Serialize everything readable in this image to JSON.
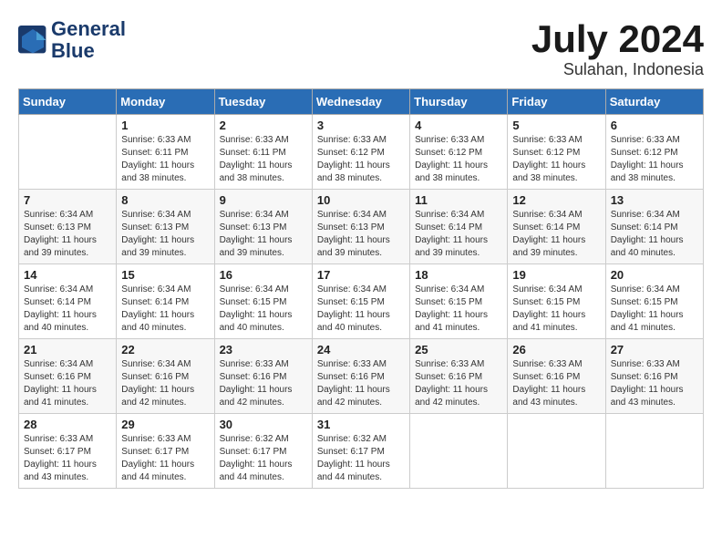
{
  "header": {
    "logo_line1": "General",
    "logo_line2": "Blue",
    "month": "July 2024",
    "location": "Sulahan, Indonesia"
  },
  "columns": [
    "Sunday",
    "Monday",
    "Tuesday",
    "Wednesday",
    "Thursday",
    "Friday",
    "Saturday"
  ],
  "weeks": [
    [
      {
        "day": "",
        "info": ""
      },
      {
        "day": "1",
        "info": "Sunrise: 6:33 AM\nSunset: 6:11 PM\nDaylight: 11 hours\nand 38 minutes."
      },
      {
        "day": "2",
        "info": "Sunrise: 6:33 AM\nSunset: 6:11 PM\nDaylight: 11 hours\nand 38 minutes."
      },
      {
        "day": "3",
        "info": "Sunrise: 6:33 AM\nSunset: 6:12 PM\nDaylight: 11 hours\nand 38 minutes."
      },
      {
        "day": "4",
        "info": "Sunrise: 6:33 AM\nSunset: 6:12 PM\nDaylight: 11 hours\nand 38 minutes."
      },
      {
        "day": "5",
        "info": "Sunrise: 6:33 AM\nSunset: 6:12 PM\nDaylight: 11 hours\nand 38 minutes."
      },
      {
        "day": "6",
        "info": "Sunrise: 6:33 AM\nSunset: 6:12 PM\nDaylight: 11 hours\nand 38 minutes."
      }
    ],
    [
      {
        "day": "7",
        "info": "Sunrise: 6:34 AM\nSunset: 6:13 PM\nDaylight: 11 hours\nand 39 minutes."
      },
      {
        "day": "8",
        "info": "Sunrise: 6:34 AM\nSunset: 6:13 PM\nDaylight: 11 hours\nand 39 minutes."
      },
      {
        "day": "9",
        "info": "Sunrise: 6:34 AM\nSunset: 6:13 PM\nDaylight: 11 hours\nand 39 minutes."
      },
      {
        "day": "10",
        "info": "Sunrise: 6:34 AM\nSunset: 6:13 PM\nDaylight: 11 hours\nand 39 minutes."
      },
      {
        "day": "11",
        "info": "Sunrise: 6:34 AM\nSunset: 6:14 PM\nDaylight: 11 hours\nand 39 minutes."
      },
      {
        "day": "12",
        "info": "Sunrise: 6:34 AM\nSunset: 6:14 PM\nDaylight: 11 hours\nand 39 minutes."
      },
      {
        "day": "13",
        "info": "Sunrise: 6:34 AM\nSunset: 6:14 PM\nDaylight: 11 hours\nand 40 minutes."
      }
    ],
    [
      {
        "day": "14",
        "info": "Sunrise: 6:34 AM\nSunset: 6:14 PM\nDaylight: 11 hours\nand 40 minutes."
      },
      {
        "day": "15",
        "info": "Sunrise: 6:34 AM\nSunset: 6:14 PM\nDaylight: 11 hours\nand 40 minutes."
      },
      {
        "day": "16",
        "info": "Sunrise: 6:34 AM\nSunset: 6:15 PM\nDaylight: 11 hours\nand 40 minutes."
      },
      {
        "day": "17",
        "info": "Sunrise: 6:34 AM\nSunset: 6:15 PM\nDaylight: 11 hours\nand 40 minutes."
      },
      {
        "day": "18",
        "info": "Sunrise: 6:34 AM\nSunset: 6:15 PM\nDaylight: 11 hours\nand 41 minutes."
      },
      {
        "day": "19",
        "info": "Sunrise: 6:34 AM\nSunset: 6:15 PM\nDaylight: 11 hours\nand 41 minutes."
      },
      {
        "day": "20",
        "info": "Sunrise: 6:34 AM\nSunset: 6:15 PM\nDaylight: 11 hours\nand 41 minutes."
      }
    ],
    [
      {
        "day": "21",
        "info": "Sunrise: 6:34 AM\nSunset: 6:16 PM\nDaylight: 11 hours\nand 41 minutes."
      },
      {
        "day": "22",
        "info": "Sunrise: 6:34 AM\nSunset: 6:16 PM\nDaylight: 11 hours\nand 42 minutes."
      },
      {
        "day": "23",
        "info": "Sunrise: 6:33 AM\nSunset: 6:16 PM\nDaylight: 11 hours\nand 42 minutes."
      },
      {
        "day": "24",
        "info": "Sunrise: 6:33 AM\nSunset: 6:16 PM\nDaylight: 11 hours\nand 42 minutes."
      },
      {
        "day": "25",
        "info": "Sunrise: 6:33 AM\nSunset: 6:16 PM\nDaylight: 11 hours\nand 42 minutes."
      },
      {
        "day": "26",
        "info": "Sunrise: 6:33 AM\nSunset: 6:16 PM\nDaylight: 11 hours\nand 43 minutes."
      },
      {
        "day": "27",
        "info": "Sunrise: 6:33 AM\nSunset: 6:16 PM\nDaylight: 11 hours\nand 43 minutes."
      }
    ],
    [
      {
        "day": "28",
        "info": "Sunrise: 6:33 AM\nSunset: 6:17 PM\nDaylight: 11 hours\nand 43 minutes."
      },
      {
        "day": "29",
        "info": "Sunrise: 6:33 AM\nSunset: 6:17 PM\nDaylight: 11 hours\nand 44 minutes."
      },
      {
        "day": "30",
        "info": "Sunrise: 6:32 AM\nSunset: 6:17 PM\nDaylight: 11 hours\nand 44 minutes."
      },
      {
        "day": "31",
        "info": "Sunrise: 6:32 AM\nSunset: 6:17 PM\nDaylight: 11 hours\nand 44 minutes."
      },
      {
        "day": "",
        "info": ""
      },
      {
        "day": "",
        "info": ""
      },
      {
        "day": "",
        "info": ""
      }
    ]
  ]
}
